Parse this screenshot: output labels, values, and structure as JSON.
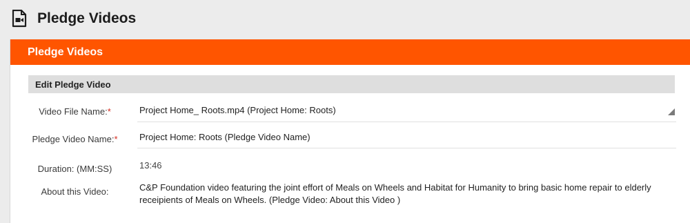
{
  "page": {
    "title": "Pledge Videos"
  },
  "panel": {
    "title": "Pledge Videos"
  },
  "section": {
    "title": "Edit Pledge Video"
  },
  "form": {
    "video_file_name": {
      "label": "Video File Name:",
      "required_mark": "*",
      "value": "Project Home_ Roots.mp4 (Project Home: Roots)"
    },
    "pledge_video_name": {
      "label": "Pledge Video Name:",
      "required_mark": "*",
      "value": "Project Home: Roots (Pledge Video Name)"
    },
    "duration": {
      "label": "Duration: (MM:SS)",
      "value": "13:46"
    },
    "about": {
      "label": "About this Video:",
      "value": "C&P Foundation video featuring the joint effort of Meals on Wheels and Habitat for Humanity to  bring basic home repair to elderly receipients of Meals on Wheels. (Pledge Video: About this Video )"
    }
  },
  "icons": {
    "page_icon": "video-file-icon",
    "select_icon": "dropdown-caret-icon"
  },
  "colors": {
    "accent": "#ff5500",
    "required": "#d52b1e"
  }
}
